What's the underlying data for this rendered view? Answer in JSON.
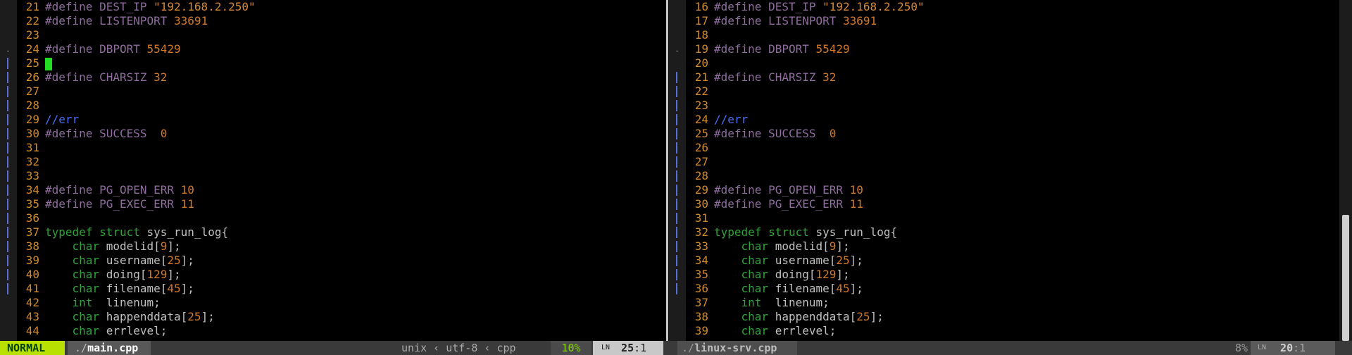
{
  "left_pane": {
    "lines": [
      {
        "n": "21",
        "parts": [
          [
            "pp",
            "#define DEST_IP "
          ],
          [
            "str",
            "\"192.168.2.250\""
          ]
        ]
      },
      {
        "n": "22",
        "parts": [
          [
            "pp",
            "#define LISTENPORT "
          ],
          [
            "num",
            "33691"
          ]
        ]
      },
      {
        "n": "23",
        "parts": []
      },
      {
        "n": "24",
        "parts": [
          [
            "pp",
            "#define DBPORT "
          ],
          [
            "num",
            "55429"
          ]
        ]
      },
      {
        "n": "25",
        "parts": [],
        "cursor": true
      },
      {
        "n": "26",
        "parts": [
          [
            "pp",
            "#define CHARSIZ "
          ],
          [
            "num",
            "32"
          ]
        ]
      },
      {
        "n": "27",
        "parts": []
      },
      {
        "n": "28",
        "parts": []
      },
      {
        "n": "29",
        "parts": [
          [
            "cm",
            "//err"
          ]
        ]
      },
      {
        "n": "30",
        "parts": [
          [
            "pp",
            "#define SUCCESS  "
          ],
          [
            "num",
            "0"
          ]
        ]
      },
      {
        "n": "31",
        "parts": []
      },
      {
        "n": "32",
        "parts": []
      },
      {
        "n": "33",
        "parts": []
      },
      {
        "n": "34",
        "parts": [
          [
            "pp",
            "#define PG_OPEN_ERR "
          ],
          [
            "num",
            "10"
          ]
        ]
      },
      {
        "n": "35",
        "parts": [
          [
            "pp",
            "#define PG_EXEC_ERR "
          ],
          [
            "num",
            "11"
          ]
        ]
      },
      {
        "n": "36",
        "parts": []
      },
      {
        "n": "37",
        "parts": [
          [
            "kw",
            "typedef struct "
          ],
          [
            "code",
            "sys_run_log{"
          ]
        ]
      },
      {
        "n": "38",
        "parts": [
          [
            "code",
            "    "
          ],
          [
            "ty",
            "char"
          ],
          [
            "code",
            " modelid["
          ],
          [
            "num",
            "9"
          ],
          [
            "code",
            "];"
          ]
        ]
      },
      {
        "n": "39",
        "parts": [
          [
            "code",
            "    "
          ],
          [
            "ty",
            "char"
          ],
          [
            "code",
            " username["
          ],
          [
            "num",
            "25"
          ],
          [
            "code",
            "];"
          ]
        ]
      },
      {
        "n": "40",
        "parts": [
          [
            "code",
            "    "
          ],
          [
            "ty",
            "char"
          ],
          [
            "code",
            " doing["
          ],
          [
            "num",
            "129"
          ],
          [
            "code",
            "];"
          ]
        ]
      },
      {
        "n": "41",
        "parts": [
          [
            "code",
            "    "
          ],
          [
            "ty",
            "char"
          ],
          [
            "code",
            " filename["
          ],
          [
            "num",
            "45"
          ],
          [
            "code",
            "];"
          ]
        ]
      },
      {
        "n": "42",
        "parts": [
          [
            "code",
            "    "
          ],
          [
            "ty",
            "int"
          ],
          [
            "code",
            "  linenum;"
          ]
        ]
      },
      {
        "n": "43",
        "parts": [
          [
            "code",
            "    "
          ],
          [
            "ty",
            "char"
          ],
          [
            "code",
            " happenddata["
          ],
          [
            "num",
            "25"
          ],
          [
            "code",
            "];"
          ]
        ]
      },
      {
        "n": "44",
        "parts": [
          [
            "code",
            "    "
          ],
          [
            "ty",
            "char"
          ],
          [
            "code",
            " errlevel;"
          ]
        ]
      }
    ]
  },
  "right_pane": {
    "lines": [
      {
        "n": "16",
        "parts": [
          [
            "pp",
            "#define DEST_IP "
          ],
          [
            "str",
            "\"192.168.2.250\""
          ]
        ]
      },
      {
        "n": "17",
        "parts": [
          [
            "pp",
            "#define LISTENPORT "
          ],
          [
            "num",
            "33691"
          ]
        ]
      },
      {
        "n": "18",
        "parts": []
      },
      {
        "n": "19",
        "parts": [
          [
            "pp",
            "#define DBPORT "
          ],
          [
            "num",
            "55429"
          ]
        ]
      },
      {
        "n": "20",
        "parts": []
      },
      {
        "n": "21",
        "parts": [
          [
            "pp",
            "#define CHARSIZ "
          ],
          [
            "num",
            "32"
          ]
        ]
      },
      {
        "n": "22",
        "parts": []
      },
      {
        "n": "23",
        "parts": []
      },
      {
        "n": "24",
        "parts": [
          [
            "cm",
            "//err"
          ]
        ]
      },
      {
        "n": "25",
        "parts": [
          [
            "pp",
            "#define SUCCESS  "
          ],
          [
            "num",
            "0"
          ]
        ]
      },
      {
        "n": "26",
        "parts": []
      },
      {
        "n": "27",
        "parts": []
      },
      {
        "n": "28",
        "parts": []
      },
      {
        "n": "29",
        "parts": [
          [
            "pp",
            "#define PG_OPEN_ERR "
          ],
          [
            "num",
            "10"
          ]
        ]
      },
      {
        "n": "30",
        "parts": [
          [
            "pp",
            "#define PG_EXEC_ERR "
          ],
          [
            "num",
            "11"
          ]
        ]
      },
      {
        "n": "31",
        "parts": []
      },
      {
        "n": "32",
        "parts": [
          [
            "kw",
            "typedef struct "
          ],
          [
            "code",
            "sys_run_log{"
          ]
        ]
      },
      {
        "n": "33",
        "parts": [
          [
            "code",
            "    "
          ],
          [
            "ty",
            "char"
          ],
          [
            "code",
            " modelid["
          ],
          [
            "num",
            "9"
          ],
          [
            "code",
            "];"
          ]
        ]
      },
      {
        "n": "34",
        "parts": [
          [
            "code",
            "    "
          ],
          [
            "ty",
            "char"
          ],
          [
            "code",
            " username["
          ],
          [
            "num",
            "25"
          ],
          [
            "code",
            "];"
          ]
        ]
      },
      {
        "n": "35",
        "parts": [
          [
            "code",
            "    "
          ],
          [
            "ty",
            "char"
          ],
          [
            "code",
            " doing["
          ],
          [
            "num",
            "129"
          ],
          [
            "code",
            "];"
          ]
        ]
      },
      {
        "n": "36",
        "parts": [
          [
            "code",
            "    "
          ],
          [
            "ty",
            "char"
          ],
          [
            "code",
            " filename["
          ],
          [
            "num",
            "45"
          ],
          [
            "code",
            "];"
          ]
        ]
      },
      {
        "n": "37",
        "parts": [
          [
            "code",
            "    "
          ],
          [
            "ty",
            "int"
          ],
          [
            "code",
            "  linenum;"
          ]
        ]
      },
      {
        "n": "38",
        "parts": [
          [
            "code",
            "    "
          ],
          [
            "ty",
            "char"
          ],
          [
            "code",
            " happenddata["
          ],
          [
            "num",
            "25"
          ],
          [
            "code",
            "];"
          ]
        ]
      },
      {
        "n": "39",
        "parts": [
          [
            "code",
            "    "
          ],
          [
            "ty",
            "char"
          ],
          [
            "code",
            " errlevel;"
          ]
        ]
      }
    ]
  },
  "status": {
    "mode": "NORMAL",
    "left_file_dir": "./",
    "left_file_base": "main.cpp",
    "left_fileformat": "unix",
    "left_encoding": "utf-8",
    "left_filetype": "cpp",
    "left_percent": "10%",
    "left_line": "25",
    "left_col": ":1",
    "right_file_dir": "./",
    "right_file_base": "linux-srv.cpp",
    "right_percent": "8%",
    "right_line": "20",
    "right_col": ":1",
    "ln_icon": "LN"
  },
  "colors": {
    "mode_bg": "#b8e000",
    "preproc": "#8f6d9e",
    "number": "#d07a2a",
    "comment": "#4d6cf0",
    "keyword": "#31a33a",
    "cursor": "#22dd22",
    "sign_mark": "#5a6fd6"
  }
}
